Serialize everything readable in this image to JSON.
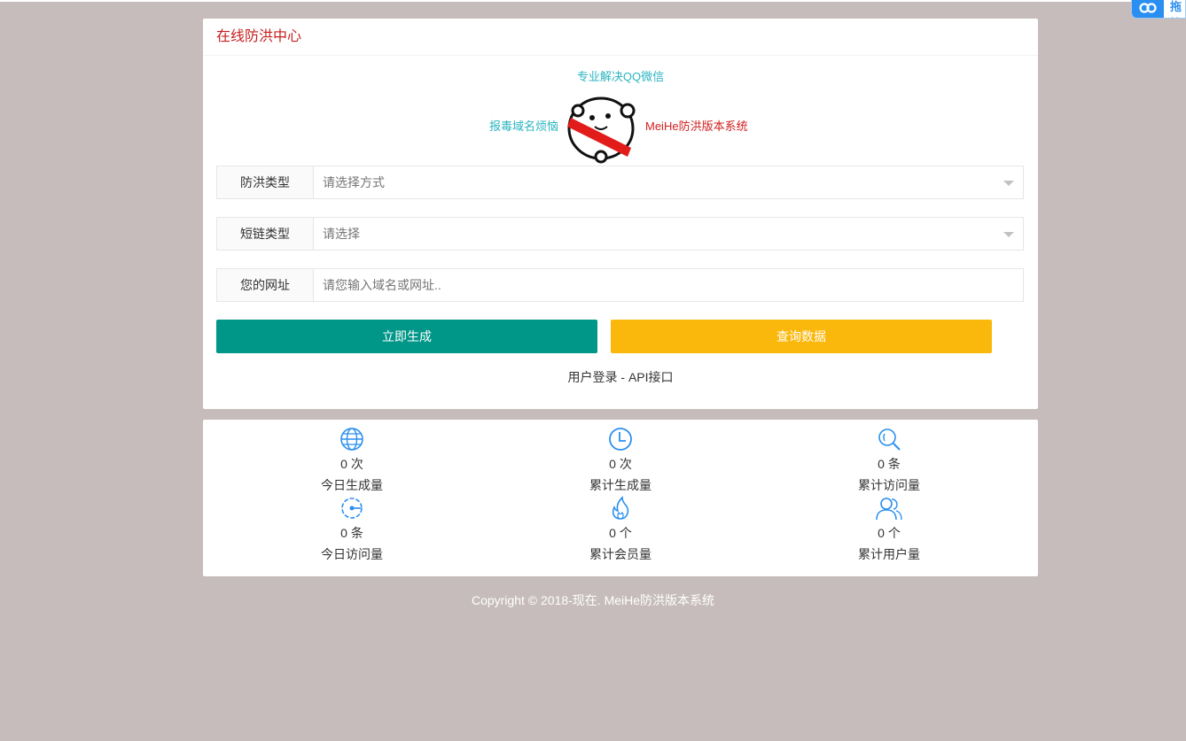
{
  "header": {
    "title": "在线防洪中心"
  },
  "promo": {
    "top": "专业解决QQ微信",
    "left": "报毒域名烦恼",
    "right": "MeiHe防洪版本系统"
  },
  "form": {
    "type_label": "防洪类型",
    "type_value": "请选择方式",
    "shortlink_label": "短链类型",
    "shortlink_value": "请选择",
    "url_label": "您的网址",
    "url_placeholder": "请您输入域名或网址.."
  },
  "buttons": {
    "generate": "立即生成",
    "query": "查询数据"
  },
  "links": {
    "login": "用户登录",
    "separator": "-",
    "api": "API接口"
  },
  "stats": [
    {
      "icon": "globe-icon",
      "value": "0 次",
      "label": "今日生成量"
    },
    {
      "icon": "clock-icon",
      "value": "0 次",
      "label": "累计生成量"
    },
    {
      "icon": "search-icon",
      "value": "0 条",
      "label": "累计访问量"
    },
    {
      "icon": "gauge-icon",
      "value": "0 条",
      "label": "今日访问量"
    },
    {
      "icon": "fire-icon",
      "value": "0 个",
      "label": "累计会员量"
    },
    {
      "icon": "users-icon",
      "value": "0 个",
      "label": "累计用户量"
    }
  ],
  "footer": {
    "text": "Copyright © 2018-现在. MeiHe防洪版本系统"
  },
  "corner_widget": {
    "icon": "link-icon",
    "text": "拖拽"
  },
  "colors": {
    "page_bg": "#c6bcbb",
    "title": "#c61f1f",
    "promo_cyan": "#2ab4c0",
    "promo_red": "#d12020",
    "generate_btn": "#009688",
    "query_btn": "#fbb80c",
    "stat_icon": "#2a8ff0"
  }
}
